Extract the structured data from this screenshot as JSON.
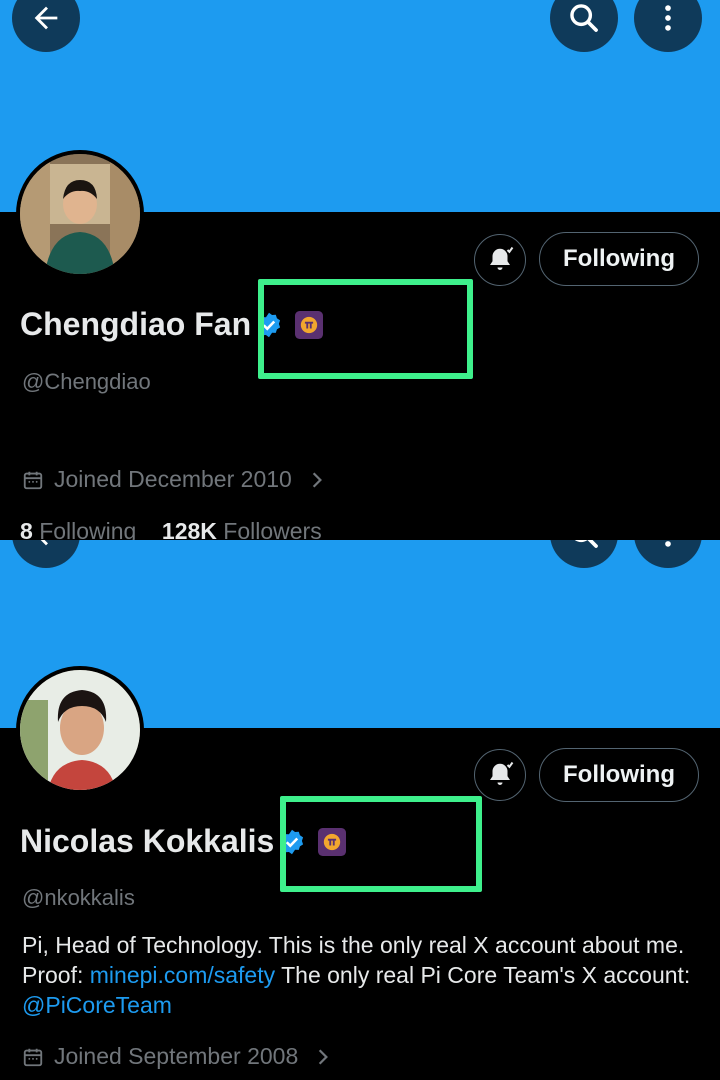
{
  "profiles": [
    {
      "name": "Chengdiao Fan",
      "handle": "@Chengdiao",
      "follow_label": "Following",
      "joined": "Joined December 2010",
      "following_count": "8",
      "following_label": "Following",
      "followers_count": "128K",
      "followers_label": "Followers"
    },
    {
      "name": "Nicolas Kokkalis",
      "handle": "@nkokkalis",
      "follow_label": "Following",
      "bio_part1": "Pi, Head of Technology.  This is the only real X account about me. Proof: ",
      "bio_link1": "minepi.com/safety",
      "bio_part2": "  The only real Pi Core Team's X account: ",
      "bio_link2": "@PiCoreTeam",
      "joined": "Joined September 2008"
    }
  ],
  "colors": {
    "banner": "#1d9bf0",
    "highlight": "#3ef08c",
    "verified": "#1d9bf0",
    "pi_badge": "#5a3070"
  },
  "icons": [
    "back-arrow-icon",
    "search-icon",
    "more-vertical-icon",
    "bell-icon",
    "verified-badge-icon",
    "pi-network-badge-icon",
    "calendar-icon",
    "chevron-right-icon"
  ]
}
